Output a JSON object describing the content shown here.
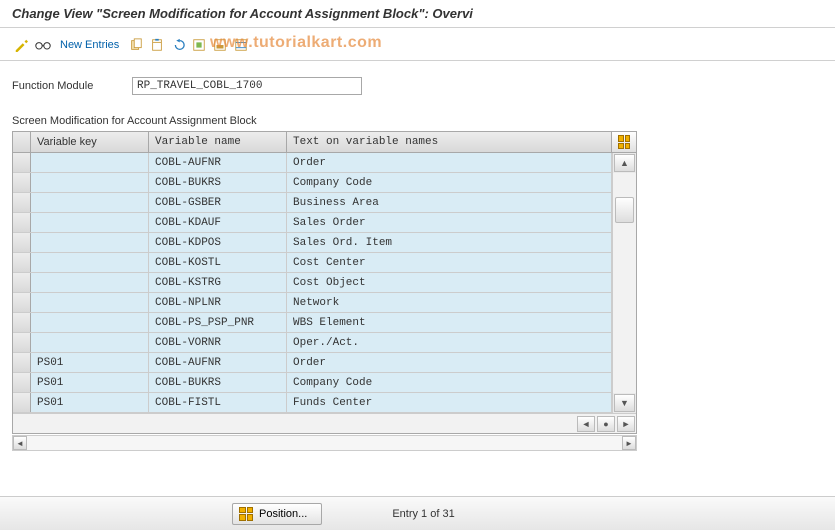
{
  "title": "Change View \"Screen Modification for Account Assignment Block\": Overvi",
  "toolbar": {
    "new_entries_label": "New Entries"
  },
  "watermark": "www.tutorialkart.com",
  "form": {
    "function_module_label": "Function Module",
    "function_module_value": "RP_TRAVEL_COBL_1700"
  },
  "section_title": "Screen Modification for Account Assignment Block",
  "columns": {
    "key": "Variable key",
    "name": "Variable name",
    "text": "Text on variable names"
  },
  "rows": [
    {
      "key": "",
      "name": "COBL-AUFNR",
      "text": "Order"
    },
    {
      "key": "",
      "name": "COBL-BUKRS",
      "text": "Company Code"
    },
    {
      "key": "",
      "name": "COBL-GSBER",
      "text": "Business Area"
    },
    {
      "key": "",
      "name": "COBL-KDAUF",
      "text": "Sales Order"
    },
    {
      "key": "",
      "name": "COBL-KDPOS",
      "text": "Sales Ord. Item"
    },
    {
      "key": "",
      "name": "COBL-KOSTL",
      "text": "Cost Center"
    },
    {
      "key": "",
      "name": "COBL-KSTRG",
      "text": "Cost Object"
    },
    {
      "key": "",
      "name": "COBL-NPLNR",
      "text": "Network"
    },
    {
      "key": "",
      "name": "COBL-PS_PSP_PNR",
      "text": "WBS Element"
    },
    {
      "key": "",
      "name": "COBL-VORNR",
      "text": "Oper./Act."
    },
    {
      "key": "PS01",
      "name": "COBL-AUFNR",
      "text": "Order"
    },
    {
      "key": "PS01",
      "name": "COBL-BUKRS",
      "text": "Company Code"
    },
    {
      "key": "PS01",
      "name": "COBL-FISTL",
      "text": "Funds Center"
    }
  ],
  "footer": {
    "position_label": "Position...",
    "entry_text": "Entry 1 of 31"
  }
}
